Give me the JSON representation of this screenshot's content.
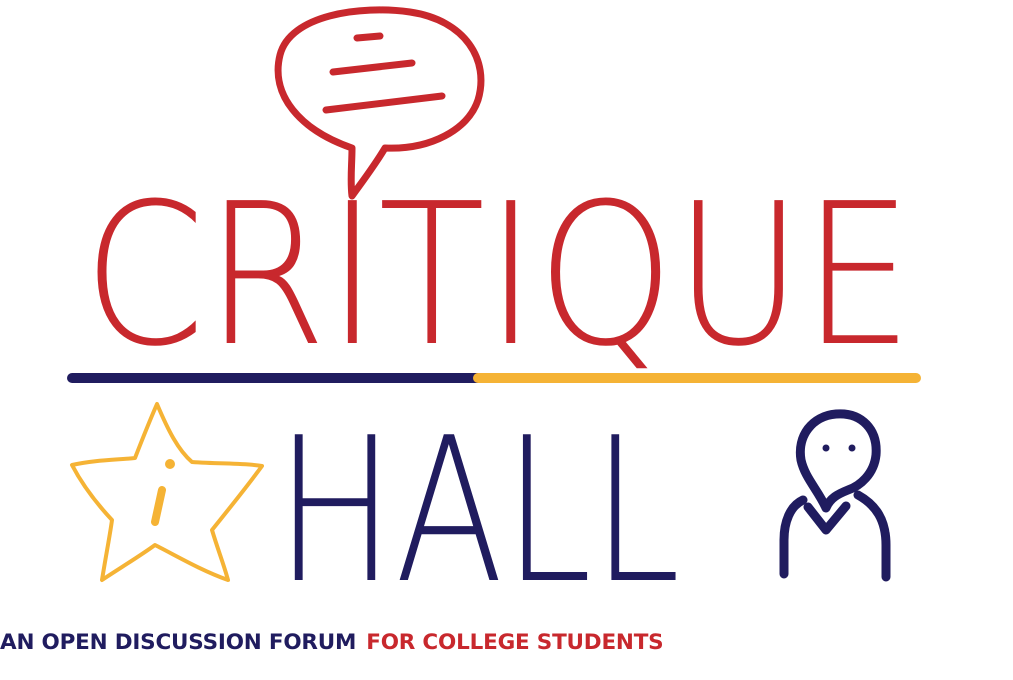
{
  "logo": {
    "word_top": "CRITIQUE",
    "word_bottom": "HALL",
    "tagline": {
      "part1": "AN OPEN DISCUSSION FORUM",
      "part2": "FOR COLLEGE STUDENTS"
    },
    "icons": [
      "speech-bubble-icon",
      "star-icon",
      "person-icon"
    ]
  },
  "colors": {
    "red": "#c8282d",
    "navy": "#201c5f",
    "gold": "#f5b335",
    "background": "#ffffff"
  }
}
